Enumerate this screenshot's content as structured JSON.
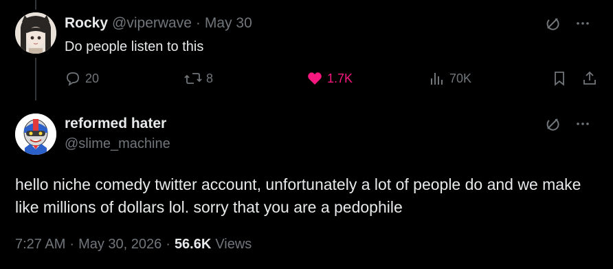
{
  "reply_parent": {
    "author_name": "Rocky",
    "author_handle": "@viperwave",
    "separator": "·",
    "date": "May 30",
    "text": "Do people listen to this",
    "actions": {
      "replies": "20",
      "reposts": "8",
      "likes": "1.7K",
      "views": "70K"
    }
  },
  "main_tweet": {
    "author_name": "reformed hater",
    "author_handle": "@slime_machine",
    "text": "hello niche comedy twitter account, unfortunately a lot of people do and we make like millions of dollars lol. sorry that you are a pedophile",
    "time": "7:27 AM",
    "separator1": "·",
    "date": "May 30, 2026",
    "separator2": "·",
    "views_count": "56.6K",
    "views_label": "Views"
  },
  "colors": {
    "background": "#000000",
    "primary_text": "#e7e9ea",
    "secondary_text": "#71767b",
    "like_active": "#f91880",
    "thread_line": "#333639"
  },
  "icons": [
    "reply-icon",
    "repost-icon",
    "like-icon",
    "views-icon",
    "bookmark-icon",
    "share-icon",
    "grok-icon",
    "more-icon"
  ]
}
